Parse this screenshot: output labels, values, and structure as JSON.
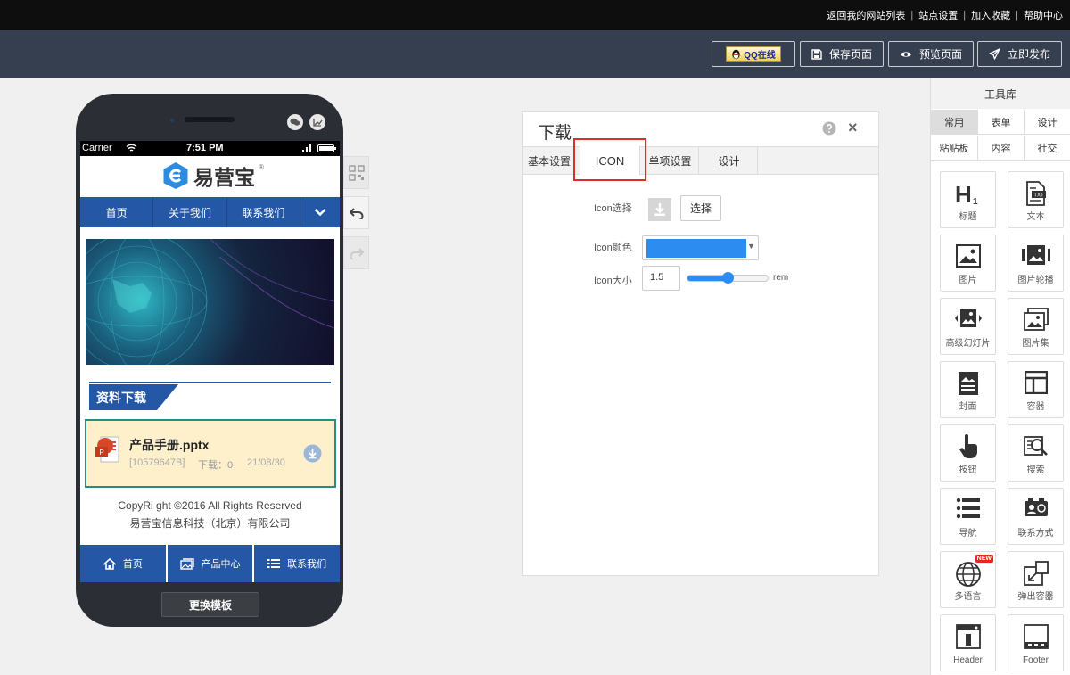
{
  "topbar": {
    "links": [
      "返回我的网站列表",
      "站点设置",
      "加入收藏",
      "帮助中心"
    ],
    "separators": [
      "|",
      "|",
      "|"
    ]
  },
  "toolbar": {
    "qq_label": "QQ在线",
    "save_label": "保存页面",
    "preview_label": "预览页面",
    "publish_label": "立即发布"
  },
  "phone": {
    "carrier": "Carrier",
    "time": "7:51 PM",
    "logo_text": "易营宝",
    "logo_mark": "®",
    "nav": [
      "首页",
      "关于我们",
      "联系我们"
    ],
    "section_title": "资料下载",
    "download": {
      "filename": "产品手册.pptx",
      "size": "[10579647B]",
      "count_label": "下载：0",
      "date": "21/08/30"
    },
    "copyright": "CopyRi ght ©2016 All Rights Reserved",
    "company": "易营宝信息科技（北京）有限公司",
    "footer_tabs": [
      "首页",
      "产品中心",
      "联系我们"
    ],
    "change_template": "更换模板"
  },
  "panel": {
    "title": "下载",
    "help_icon": "help-icon",
    "close_label": "×",
    "tabs": [
      "基本设置",
      "ICON",
      "单项设置",
      "设计"
    ],
    "active_tab": "ICON",
    "icon_select_label": "Icon选择",
    "select_button": "选择",
    "icon_color_label": "Icon颜色",
    "icon_color_value": "#2d8cf0",
    "icon_size_label": "Icon大小",
    "icon_size_value": "1.5",
    "icon_size_slider_fraction": 0.5,
    "icon_size_unit": "rem"
  },
  "library": {
    "title": "工具库",
    "tabs_row1": [
      "常用",
      "表单",
      "设计"
    ],
    "tabs_row2": [
      "粘贴板",
      "内容",
      "社交"
    ],
    "items": [
      "标题",
      "文本",
      "图片",
      "图片轮播",
      "高级幻灯片",
      "图片集",
      "封面",
      "容器",
      "按钮",
      "搜索",
      "导航",
      "联系方式",
      "多语言",
      "弹出容器",
      "Header",
      "Footer"
    ],
    "new_badge": "NEW"
  },
  "colors": {
    "accent_blue": "#2458a6",
    "highlight_red": "#d9302c",
    "toolbar_bg": "#363f4f"
  }
}
